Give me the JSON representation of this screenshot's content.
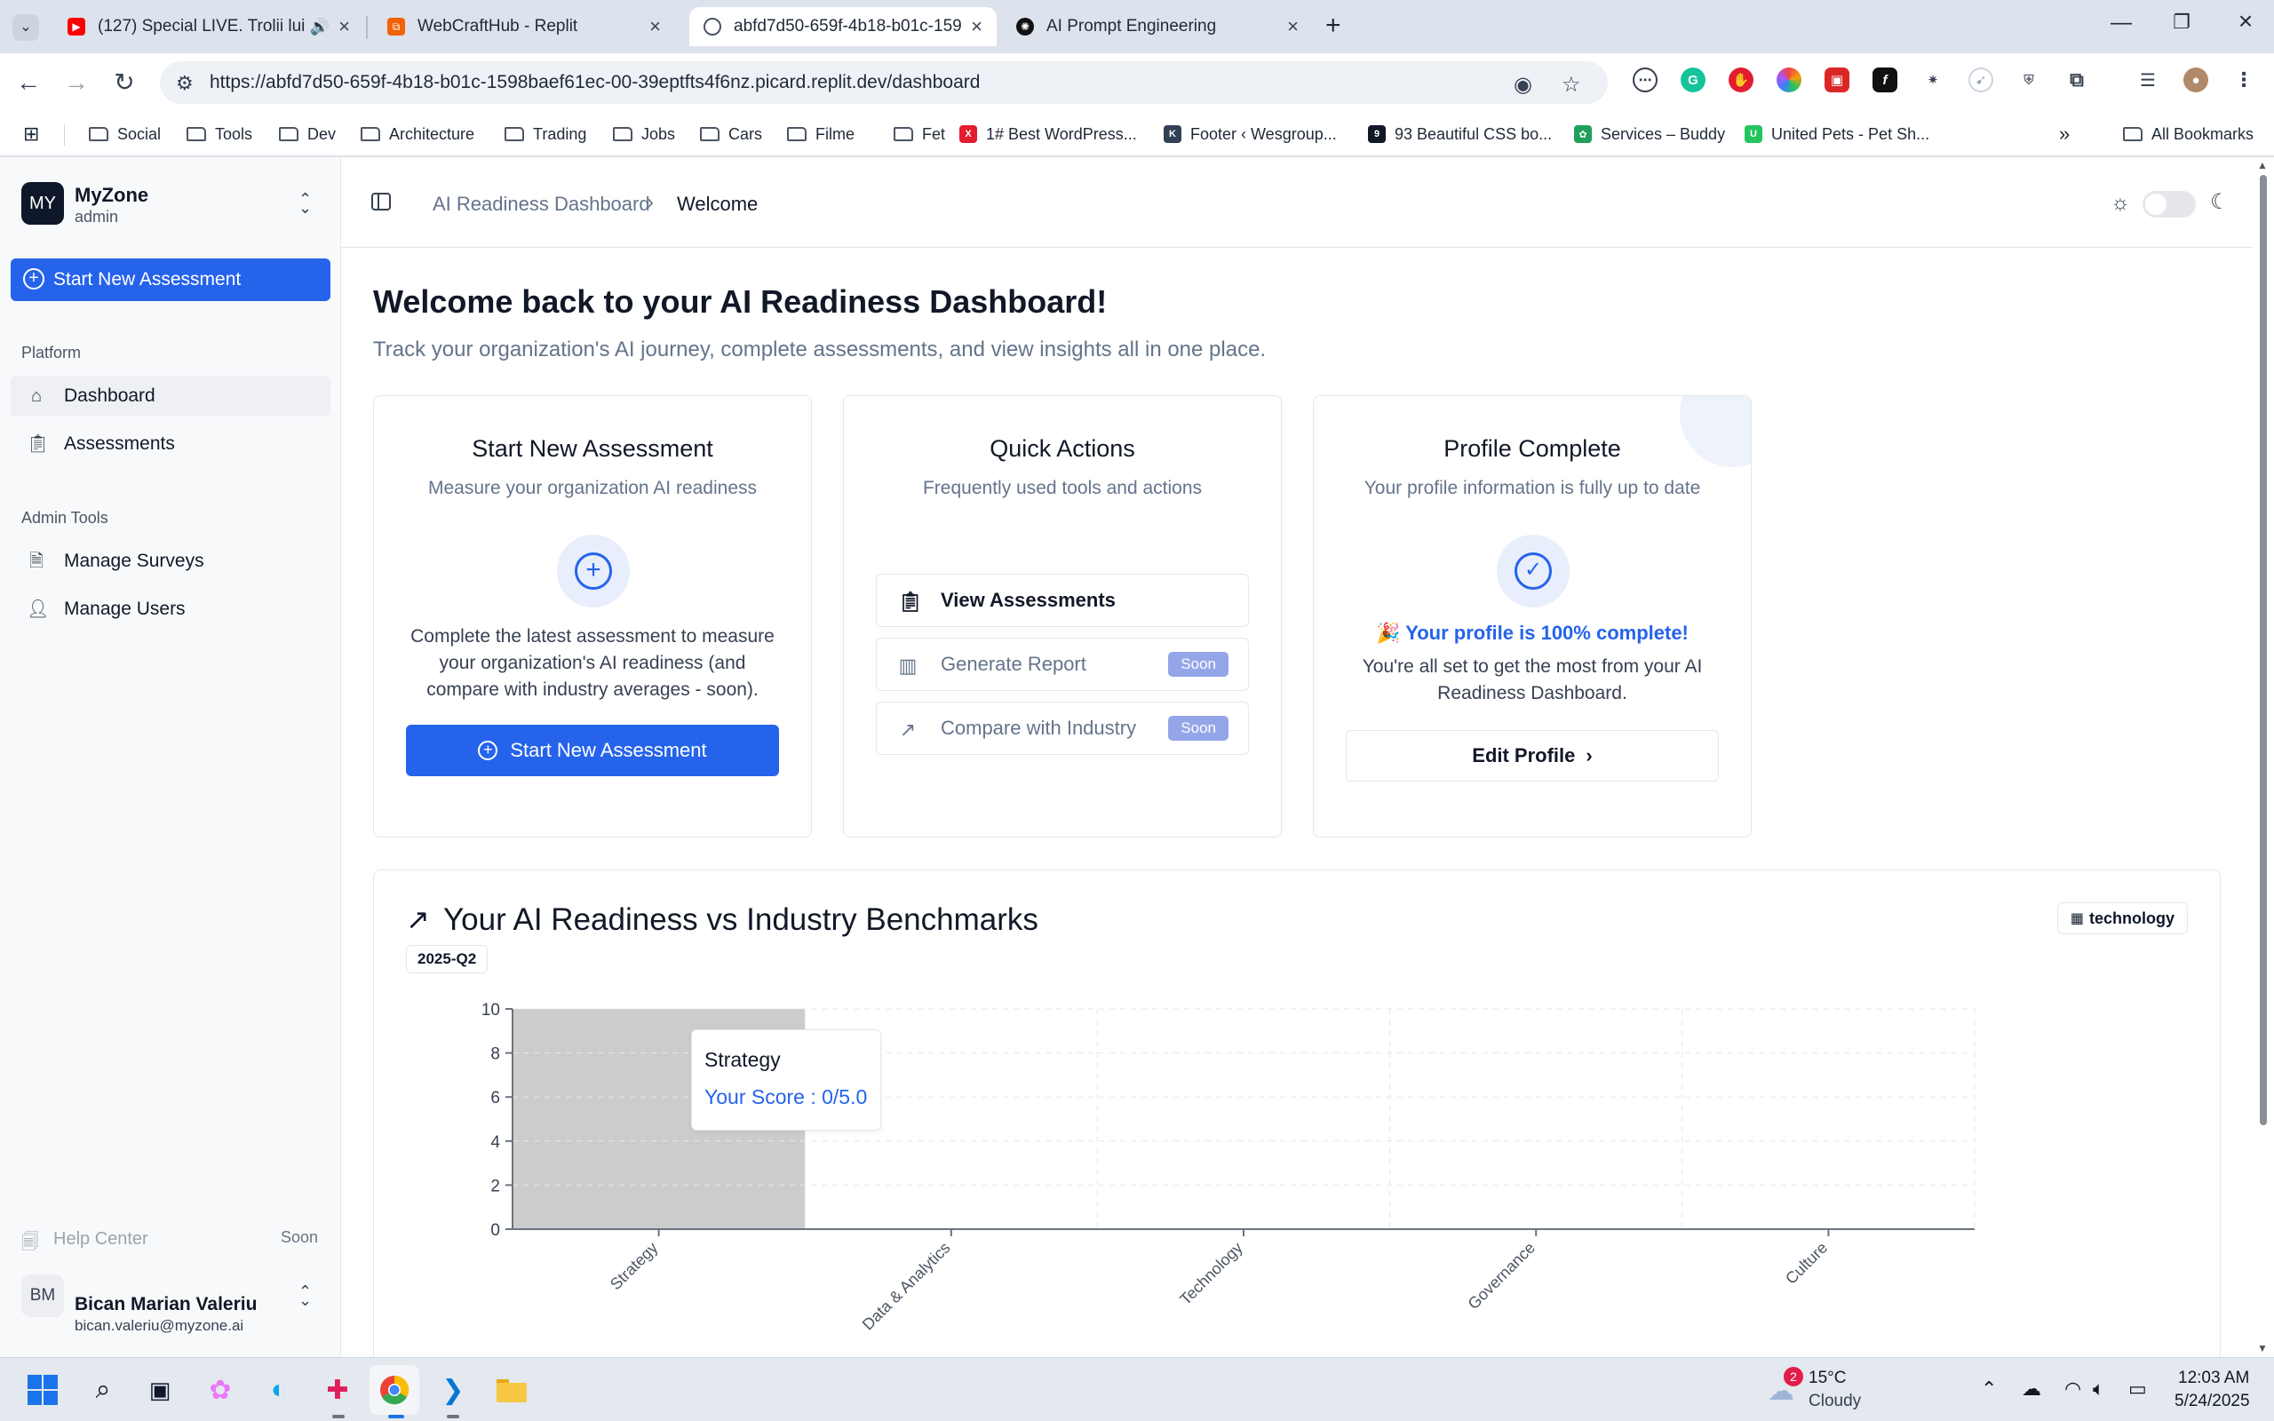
{
  "browser": {
    "tabs": [
      {
        "title": "(127) Special LIVE. Trolii lui I",
        "favicon": "youtube-icon"
      },
      {
        "title": "WebCraftHub - Replit",
        "favicon": "replit-icon"
      },
      {
        "title": "abfd7d50-659f-4b18-b01c-159",
        "favicon": "globe-icon",
        "active": true
      },
      {
        "title": "AI Prompt Engineering",
        "favicon": "openai-icon"
      }
    ],
    "url": "https://abfd7d50-659f-4b18-b01c-1598baef61ec-00-39eptfts4f6nz.picard.replit.dev/dashboard",
    "bookmarks": [
      {
        "label": "Social",
        "type": "folder"
      },
      {
        "label": "Tools",
        "type": "folder"
      },
      {
        "label": "Dev",
        "type": "folder"
      },
      {
        "label": "Architecture",
        "type": "folder"
      },
      {
        "label": "Trading",
        "type": "folder"
      },
      {
        "label": "Jobs",
        "type": "folder"
      },
      {
        "label": "Cars",
        "type": "folder"
      },
      {
        "label": "Filme",
        "type": "folder"
      },
      {
        "label": "Fet",
        "type": "folder"
      },
      {
        "label": "1# Best WordPress...",
        "type": "link",
        "color": "#e11d2e",
        "glyph": "X"
      },
      {
        "label": "Footer ‹ Wesgroup...",
        "type": "link",
        "color": "#334155",
        "glyph": "K"
      },
      {
        "label": "93 Beautiful CSS bo...",
        "type": "link",
        "color": "#111827",
        "glyph": "9"
      },
      {
        "label": "Services – Buddy",
        "type": "link",
        "color": "#22a05a",
        "glyph": "✿"
      },
      {
        "label": "United Pets - Pet Sh...",
        "type": "link",
        "color": "#22c55e",
        "glyph": "U"
      }
    ],
    "all_bookmarks": "All Bookmarks"
  },
  "workspace": {
    "initials": "MY",
    "name": "MyZone",
    "role": "admin"
  },
  "sidebar": {
    "cta": "Start New Assessment",
    "platform_label": "Platform",
    "platform_items": [
      {
        "label": "Dashboard",
        "icon": "home-icon"
      },
      {
        "label": "Assessments",
        "icon": "clipboard-icon"
      }
    ],
    "admin_label": "Admin Tools",
    "admin_items": [
      {
        "label": "Manage Surveys",
        "icon": "document-icon"
      },
      {
        "label": "Manage Users",
        "icon": "users-icon"
      }
    ],
    "help": {
      "label": "Help Center",
      "badge": "Soon"
    },
    "user": {
      "initials": "BM",
      "name": "Bican Marian Valeriu",
      "email": "bican.valeriu@myzone.ai"
    }
  },
  "breadcrumb": {
    "parent": "AI Readiness Dashboard",
    "current": "Welcome"
  },
  "welcome": {
    "title": "Welcome back to your AI Readiness Dashboard!",
    "subtitle": "Track your organization's AI journey, complete assessments, and view insights all in one place."
  },
  "cards": {
    "assessment": {
      "title": "Start New Assessment",
      "subtitle": "Measure your organization AI readiness",
      "body": "Complete the latest assessment to measure your organization's AI readiness (and compare with industry averages - soon).",
      "button": "Start New Assessment"
    },
    "quick_actions": {
      "title": "Quick Actions",
      "subtitle": "Frequently used tools and actions",
      "items": [
        {
          "label": "View Assessments",
          "badge": ""
        },
        {
          "label": "Generate Report",
          "badge": "Soon"
        },
        {
          "label": "Compare with Industry",
          "badge": "Soon"
        }
      ]
    },
    "profile": {
      "title": "Profile Complete",
      "subtitle": "Your profile information is fully up to date",
      "status": "🎉 Your profile is 100% complete!",
      "body": "You're all set to get the most from your AI Readiness Dashboard.",
      "button": "Edit Profile"
    }
  },
  "benchmark": {
    "title": "Your AI Readiness vs Industry Benchmarks",
    "period": "2025-Q2",
    "industry": "technology",
    "tooltip": {
      "category": "Strategy",
      "label": "Your Score : 0/5.0"
    }
  },
  "chart_data": {
    "type": "bar",
    "categories": [
      "Strategy",
      "Data & Analytics",
      "Technology",
      "Governance",
      "Culture"
    ],
    "series": [
      {
        "values": [
          0,
          0,
          0,
          0,
          0
        ]
      }
    ],
    "highlight": {
      "category": "Strategy",
      "color": "#cccccc"
    },
    "ylim": [
      0,
      10
    ],
    "yticks": [
      0,
      2,
      4,
      6,
      8,
      10
    ],
    "grid": true
  },
  "taskbar": {
    "weather": {
      "temp": "15°C",
      "condition": "Cloudy",
      "badge": "2"
    },
    "time": "12:03 AM",
    "date": "5/24/2025"
  }
}
